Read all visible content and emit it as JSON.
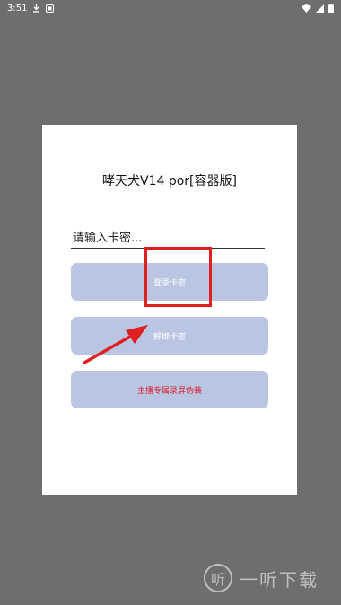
{
  "status_bar": {
    "time": "3:51"
  },
  "dialog": {
    "title": "哮天犬V14 por[容器版]",
    "input": {
      "placeholder": "请输入卡密...",
      "value": ""
    },
    "buttons": {
      "login": "登录卡密",
      "unbind": "解绑卡密",
      "disguise": "主播专属录屏伪装"
    }
  },
  "colors": {
    "button_bg": "#b9c5e3",
    "button_text": "#ffffff",
    "disguise_text": "#d9202b",
    "annotation": "#e02020",
    "overlay": "#6e6e6e"
  },
  "watermark": {
    "icon": "听",
    "text": "一听下载"
  }
}
